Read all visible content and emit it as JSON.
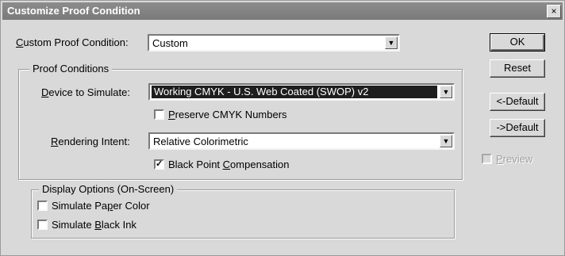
{
  "window": {
    "title": "Customize Proof Condition",
    "close_glyph": "×"
  },
  "custom_proof_condition": {
    "label_accel": "C",
    "label_rest": "ustom Proof Condition:",
    "value": "Custom"
  },
  "proof_conditions": {
    "legend": "Proof Conditions",
    "device": {
      "label_accel": "D",
      "label_rest": "evice to Simulate:",
      "value": "Working CMYK - U.S. Web Coated (SWOP) v2"
    },
    "preserve": {
      "pre": "",
      "accel": "P",
      "post": "reserve CMYK Numbers",
      "checked": false
    },
    "intent": {
      "label_accel": "R",
      "label_rest": "endering Intent:",
      "value": "Relative Colorimetric"
    },
    "bpc": {
      "pre": "Black Point ",
      "accel": "C",
      "post": "ompensation",
      "checked": true,
      "check_glyph": "✓"
    }
  },
  "display_options": {
    "legend": "Display Options (On-Screen)",
    "paper": {
      "pre": "Simulate Pa",
      "accel": "p",
      "post": "er Color",
      "checked": false
    },
    "ink": {
      "pre": "Simulate ",
      "accel": "B",
      "post": "lack Ink",
      "checked": false
    }
  },
  "buttons": {
    "ok": "OK",
    "reset": "Reset",
    "load_default": "<-Default",
    "save_default": "->Default"
  },
  "preview": {
    "accel": "P",
    "rest": "review",
    "checked": false,
    "enabled": false
  },
  "icons": {
    "dropdown": "▼"
  }
}
